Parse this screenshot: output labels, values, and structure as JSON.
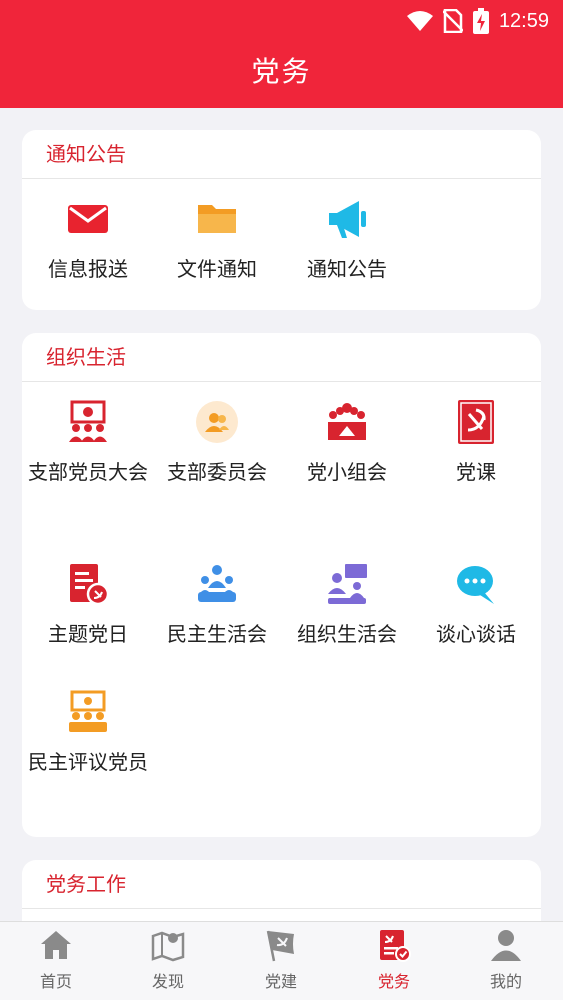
{
  "status_bar": {
    "time": "12:59"
  },
  "header": {
    "title": "党务"
  },
  "sections": [
    {
      "title": "通知公告",
      "items": [
        {
          "label": "信息报送",
          "icon": "envelope-icon"
        },
        {
          "label": "文件通知",
          "icon": "folder-icon"
        },
        {
          "label": "通知公告",
          "icon": "megaphone-icon"
        }
      ]
    },
    {
      "title": "组织生活",
      "items": [
        {
          "label": "支部党员大会",
          "icon": "party-meeting-icon"
        },
        {
          "label": "支部委员会",
          "icon": "committee-icon"
        },
        {
          "label": "党小组会",
          "icon": "group-meeting-icon"
        },
        {
          "label": "党课",
          "icon": "party-book-icon"
        },
        {
          "label": "主题党日",
          "icon": "theme-day-icon"
        },
        {
          "label": "民主生活会",
          "icon": "democratic-life-icon"
        },
        {
          "label": "组织生活会",
          "icon": "org-life-icon"
        },
        {
          "label": "谈心谈话",
          "icon": "chat-icon"
        },
        {
          "label": "民主评议党员",
          "icon": "review-icon"
        }
      ]
    },
    {
      "title": "党务工作"
    }
  ],
  "tabbar": {
    "tabs": [
      {
        "label": "首页",
        "icon": "home-icon"
      },
      {
        "label": "发现",
        "icon": "map-icon"
      },
      {
        "label": "党建",
        "icon": "party-flag-icon"
      },
      {
        "label": "党务",
        "icon": "party-affairs-icon",
        "active": true
      },
      {
        "label": "我的",
        "icon": "person-icon"
      }
    ]
  },
  "colors": {
    "primary": "#f0253a",
    "section_title": "#d8242f",
    "orange": "#f7a234",
    "cyan": "#1fb9e6",
    "blue": "#3f8fe6",
    "purple": "#7c6ad6"
  }
}
